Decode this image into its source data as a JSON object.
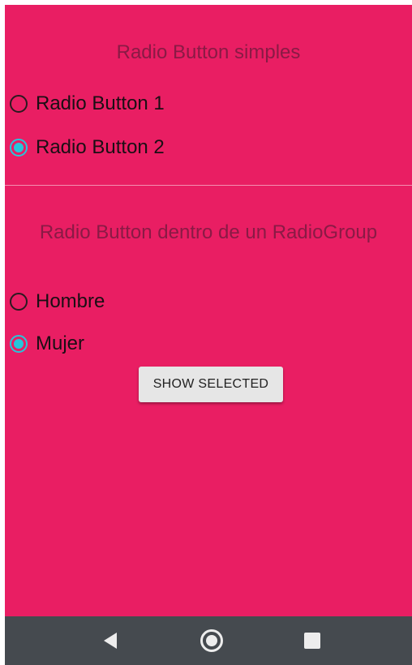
{
  "section1": {
    "title": "Radio Button simples",
    "options": [
      {
        "label": "Radio Button 1",
        "checked": false
      },
      {
        "label": "Radio Button 2",
        "checked": true
      }
    ]
  },
  "section2": {
    "title": "Radio Button dentro de un RadioGroup",
    "options": [
      {
        "label": "Hombre",
        "checked": false
      },
      {
        "label": "Mujer",
        "checked": true
      }
    ],
    "button_label": "SHOW SELECTED"
  },
  "navbar": {
    "back_icon": "back-triangle-icon",
    "home_icon": "home-circle-icon",
    "recents_icon": "recents-square-icon"
  },
  "colors": {
    "background": "#E91E63",
    "accent": "#26C6DA",
    "navbar": "#454A4F"
  }
}
